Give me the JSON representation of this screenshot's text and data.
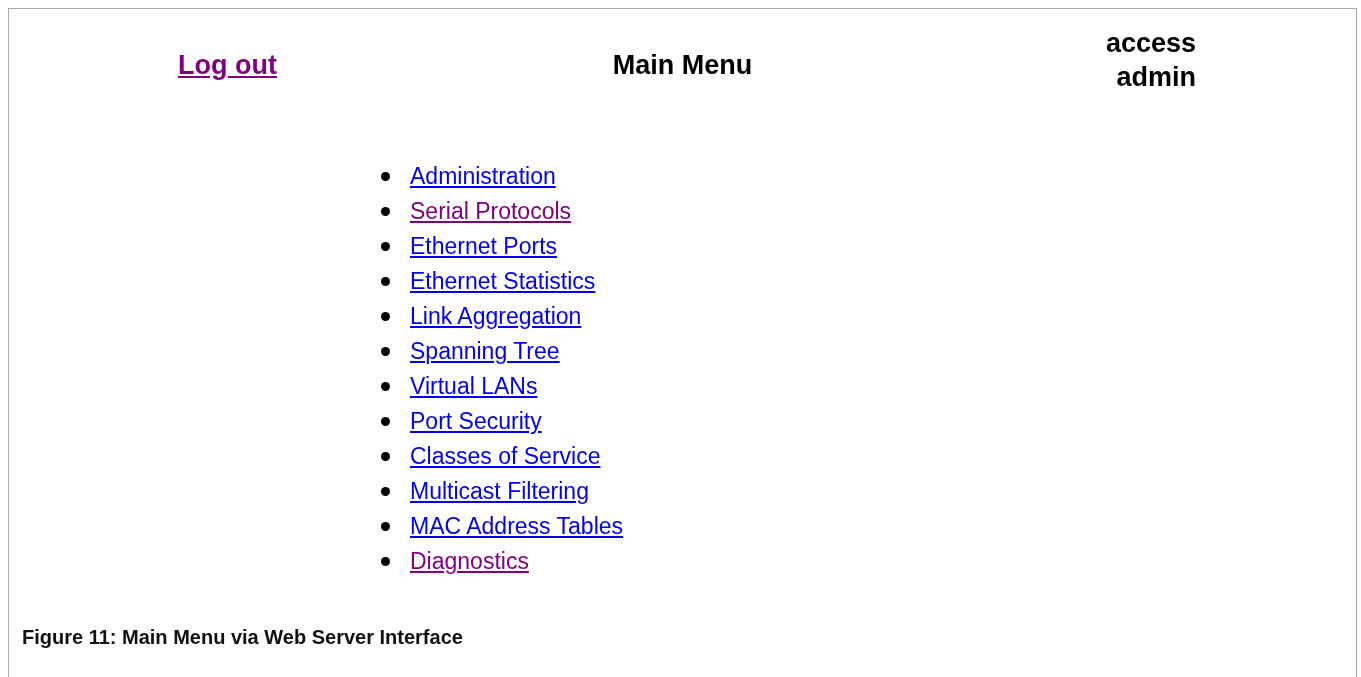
{
  "header": {
    "logout": {
      "label": "Log out",
      "visited": true
    },
    "title": "Main Menu",
    "access": {
      "label": "access",
      "level_name": "admin"
    }
  },
  "menu": [
    {
      "label": "Administration",
      "visited": false
    },
    {
      "label": "Serial Protocols",
      "visited": true
    },
    {
      "label": "Ethernet Ports",
      "visited": false
    },
    {
      "label": "Ethernet Statistics",
      "visited": false
    },
    {
      "label": "Link Aggregation",
      "visited": false
    },
    {
      "label": "Spanning Tree",
      "visited": false
    },
    {
      "label": "Virtual LANs",
      "visited": false
    },
    {
      "label": "Port Security",
      "visited": false
    },
    {
      "label": "Classes of Service",
      "visited": false
    },
    {
      "label": "Multicast Filtering",
      "visited": false
    },
    {
      "label": "MAC Address Tables",
      "visited": false
    },
    {
      "label": "Diagnostics",
      "visited": true
    }
  ],
  "caption": "Figure 11: Main Menu via Web Server Interface"
}
